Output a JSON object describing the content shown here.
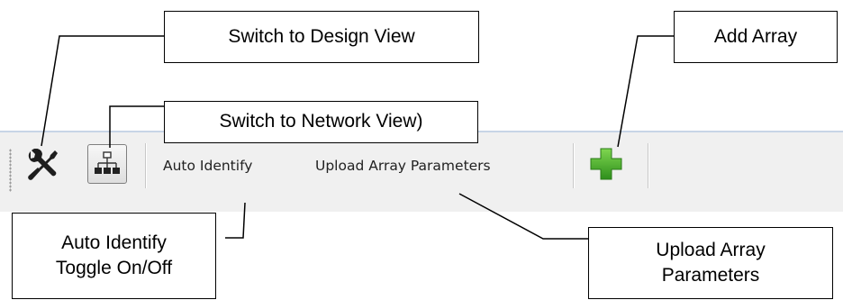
{
  "toolbar": {
    "auto_identify_label": "Auto Identify",
    "upload_params_label": "Upload Array Parameters",
    "icons": {
      "design_view": "wrench-screwdriver-icon",
      "network_view": "network-tree-icon",
      "add_array": "green-plus-icon"
    }
  },
  "callouts": {
    "design_view": "Switch to Design View",
    "network_view": "Switch to Network View)",
    "add_array": "Add Array",
    "auto_identify": [
      "Auto Identify",
      "Toggle On/Off"
    ],
    "upload_params": [
      "Upload Array",
      "Parameters"
    ]
  },
  "colors": {
    "toolbar_bg": "#f0f0f0",
    "plus_green": "#4caf2a",
    "icon_dark": "#1e1e1e"
  }
}
